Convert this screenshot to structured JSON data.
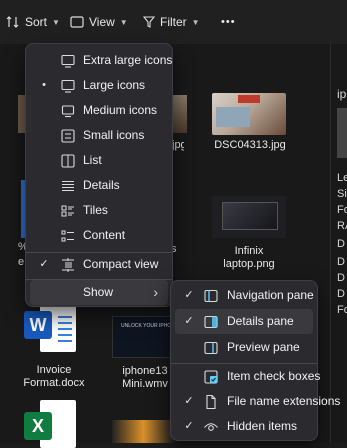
{
  "toolbar": {
    "sort_label": "Sort",
    "view_label": "View",
    "filter_label": "Filter",
    "more_label": "•••"
  },
  "files": {
    "dsc_label": "DSC04313.jpg",
    "jpg_partial": "jpg",
    "infinix_line1": "Infinix",
    "infinix_line2": "laptop.png",
    "invoice_line1": "Invoice",
    "invoice_line2": "Format.docx",
    "iphone_line1": "iphone13",
    "iphone_line2": "Mini.wmv",
    "partial_left_1": "%",
    "partial_left_2": "e",
    "partial_s": "s",
    "thumb_text": "UNLOCK YOUR IPHONE"
  },
  "details_pane": {
    "lines": [
      "ip",
      "Le",
      "Si",
      "Fo",
      "RA",
      "D",
      "D",
      "D",
      "D",
      "Fo"
    ]
  },
  "view_menu": {
    "items": [
      {
        "label": "Extra large icons",
        "icon": "monitor-icon",
        "mark": ""
      },
      {
        "label": "Large icons",
        "icon": "monitor-icon",
        "mark": "•"
      },
      {
        "label": "Medium icons",
        "icon": "monitor-icon",
        "mark": ""
      },
      {
        "label": "Small icons",
        "icon": "small-icons-icon",
        "mark": ""
      },
      {
        "label": "List",
        "icon": "list-icon",
        "mark": ""
      },
      {
        "label": "Details",
        "icon": "details-icon",
        "mark": ""
      },
      {
        "label": "Tiles",
        "icon": "tiles-icon",
        "mark": ""
      },
      {
        "label": "Content",
        "icon": "content-icon",
        "mark": ""
      }
    ],
    "compact": {
      "label": "Compact view",
      "icon": "compact-view-icon",
      "mark": "✓"
    },
    "show": {
      "label": "Show",
      "arrow": "›"
    }
  },
  "show_menu": {
    "items": [
      {
        "label": "Navigation pane",
        "icon": "navigation-pane-icon",
        "mark": "✓"
      },
      {
        "label": "Details pane",
        "icon": "details-pane-icon",
        "mark": "✓"
      },
      {
        "label": "Preview pane",
        "icon": "preview-pane-icon",
        "mark": ""
      },
      {
        "label": "Item check boxes",
        "icon": "checkbox-icon",
        "mark": ""
      },
      {
        "label": "File name extensions",
        "icon": "file-icon",
        "mark": "✓"
      },
      {
        "label": "Hidden items",
        "icon": "eye-icon",
        "mark": "✓"
      }
    ]
  },
  "colors": {
    "accent": "#60cdff",
    "word_blue": "#185abd",
    "excel_green": "#107c41",
    "menu_bg": "#2c2c30"
  }
}
